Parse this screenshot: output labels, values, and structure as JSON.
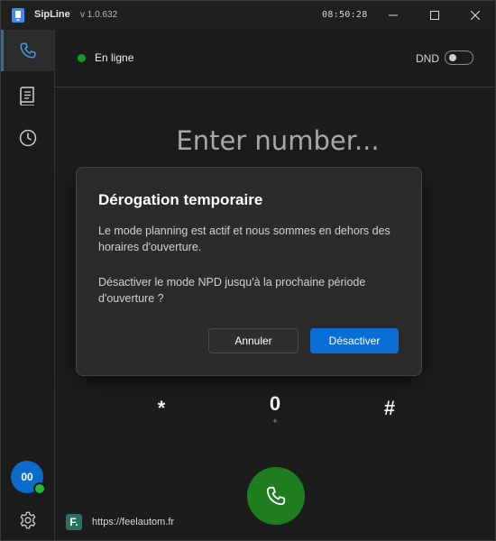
{
  "window": {
    "title": "SipLine",
    "version": "v 1.0.632",
    "clock": "08:50:28"
  },
  "sidebar": {
    "items": [
      {
        "name": "phone",
        "icon": "phone-icon",
        "active": true
      },
      {
        "name": "contacts",
        "icon": "book-icon",
        "active": false
      },
      {
        "name": "history",
        "icon": "clock-icon",
        "active": false
      }
    ],
    "avatar_initials": "00",
    "avatar_color": "#0b6bc9",
    "presence_color": "#27b53a",
    "settings_icon": "gear-icon"
  },
  "status": {
    "label": "En ligne",
    "color": "#1a9a2a"
  },
  "dnd": {
    "label": "DND",
    "enabled": false
  },
  "dialer": {
    "placeholder": "Enter number...",
    "value": "",
    "keys": [
      {
        "main": "*",
        "sub": ""
      },
      {
        "main": "0",
        "sub": "+"
      },
      {
        "main": "#",
        "sub": ""
      }
    ],
    "call_color": "#1e7d1e"
  },
  "footer": {
    "logo_letter": "F.",
    "link": "https://feelautom.fr"
  },
  "dialog": {
    "title": "Dérogation temporaire",
    "message_1": "Le mode planning est actif et nous sommes en dehors des horaires d'ouverture.",
    "message_2": "Désactiver le mode NPD jusqu'à la prochaine période d'ouverture ?",
    "cancel_label": "Annuler",
    "confirm_label": "Désactiver",
    "confirm_color": "#0b6ed6"
  }
}
